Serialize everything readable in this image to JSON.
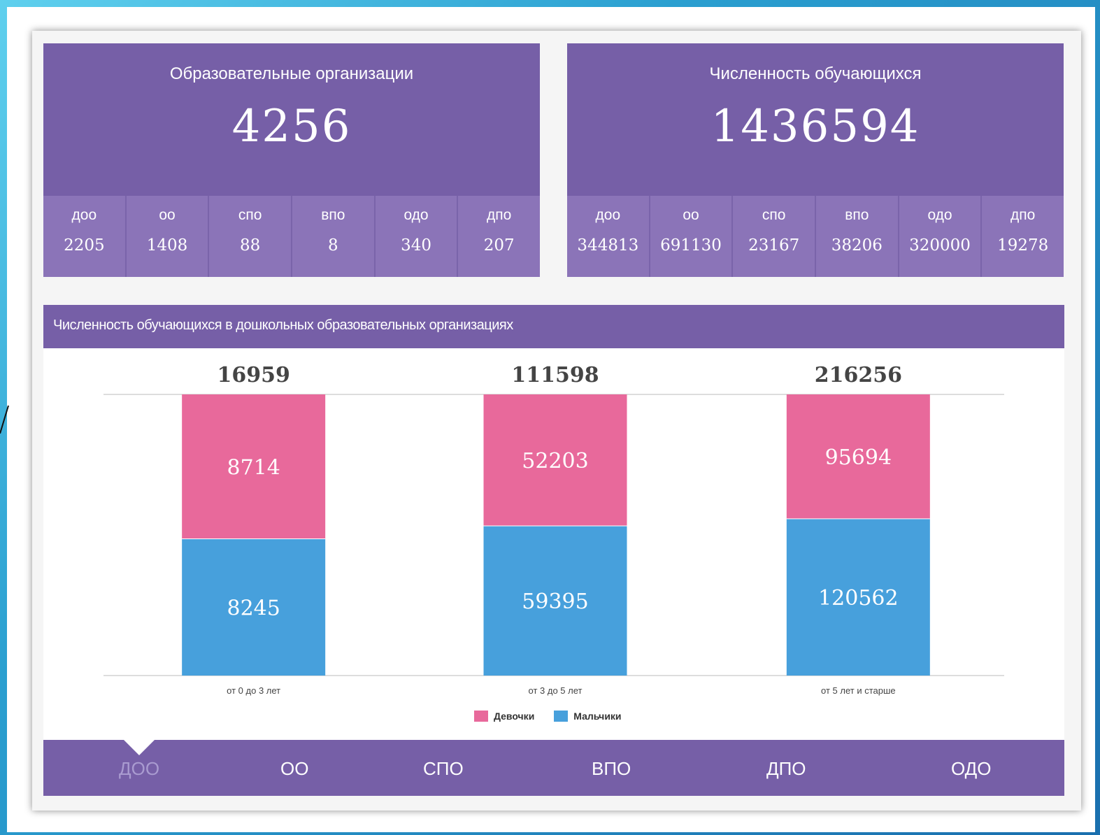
{
  "colors": {
    "panel": "#765fa7",
    "subcell": "#8b74b8",
    "girls": "#e8699b",
    "boys": "#47a0dc"
  },
  "organizations": {
    "title": "Образовательные организации",
    "total": "4256",
    "items": [
      {
        "label": "доо",
        "value": "2205"
      },
      {
        "label": "оо",
        "value": "1408"
      },
      {
        "label": "спо",
        "value": "88"
      },
      {
        "label": "впо",
        "value": "8"
      },
      {
        "label": "одо",
        "value": "340"
      },
      {
        "label": "дпо",
        "value": "207"
      }
    ]
  },
  "students": {
    "title": "Численность обучающихся",
    "total": "1436594",
    "items": [
      {
        "label": "доо",
        "value": "344813"
      },
      {
        "label": "оо",
        "value": "691130"
      },
      {
        "label": "спо",
        "value": "23167"
      },
      {
        "label": "впо",
        "value": "38206"
      },
      {
        "label": "одо",
        "value": "320000"
      },
      {
        "label": "дпо",
        "value": "19278"
      }
    ]
  },
  "chart_title": "Численность обучающихся в дошкольных образовательных организациях",
  "chart_data": {
    "type": "bar",
    "stacked": true,
    "title": "Численность обучающихся в дошкольных образовательных организациях",
    "xlabel": "",
    "ylabel": "",
    "categories": [
      "от 0 до 3 лет",
      "от 3 до 5 лет",
      "от 5 лет и старше"
    ],
    "totals": [
      "16959",
      "111598",
      "216256"
    ],
    "series": [
      {
        "name": "Девочки",
        "color": "#e8699b",
        "values": [
          8714,
          52203,
          95694
        ]
      },
      {
        "name": "Мальчики",
        "color": "#47a0dc",
        "values": [
          8245,
          59395,
          120562
        ]
      }
    ],
    "grid": false,
    "legend": "bottom"
  },
  "legend": {
    "girls": "Девочки",
    "boys": "Мальчики"
  },
  "tabs": [
    {
      "label": "ДОО",
      "active": true
    },
    {
      "label": "ОО",
      "active": false
    },
    {
      "label": "СПО",
      "active": false
    },
    {
      "label": "ВПО",
      "active": false
    },
    {
      "label": "ДПО",
      "active": false
    },
    {
      "label": "ОДО",
      "active": false
    }
  ]
}
